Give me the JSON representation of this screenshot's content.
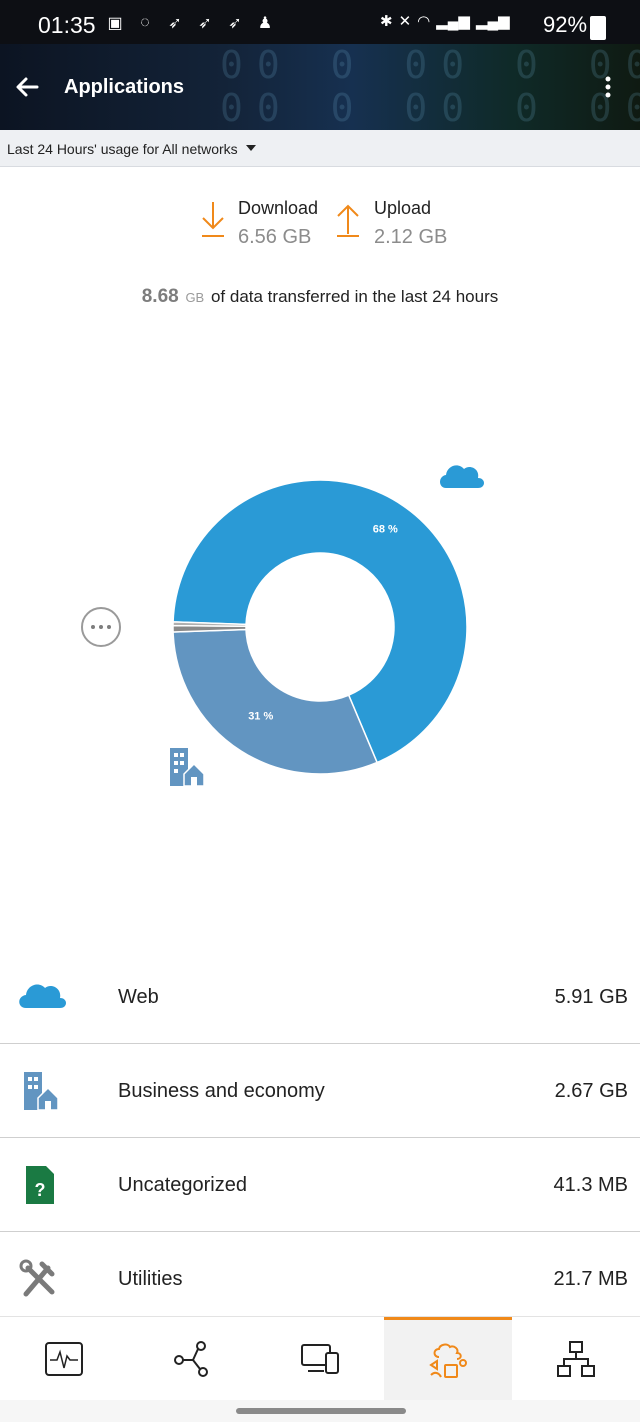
{
  "status_bar": {
    "time": "01:35",
    "battery": "92%"
  },
  "app_bar": {
    "title": "Applications"
  },
  "filter": {
    "label": "Last 24 Hours' usage for All networks"
  },
  "transfer": {
    "download_label": "Download",
    "download_value": "6.56 GB",
    "upload_label": "Upload",
    "upload_value": "2.12 GB"
  },
  "summary": {
    "total": "8.68",
    "unit": "GB",
    "text": "of data transferred in the last 24 hours"
  },
  "colors": {
    "web": "#2a9ad6",
    "business": "#6295c1",
    "uncategorized": "#8a8a8a",
    "utilities": "#b0b0b0",
    "accent": "#f0891a",
    "green": "#1a7a43"
  },
  "chart_data": {
    "type": "pie",
    "slices": [
      {
        "label": "68 %",
        "value": 68.1
      },
      {
        "label": "31 %",
        "value": 30.8
      },
      {
        "label": "",
        "value": 0.7
      },
      {
        "label": "",
        "value": 0.4
      }
    ]
  },
  "categories": [
    {
      "name": "Web",
      "value": "5.91 GB",
      "icon": "cloud-icon"
    },
    {
      "name": "Business and economy",
      "value": "2.67 GB",
      "icon": "building-icon"
    },
    {
      "name": "Uncategorized",
      "value": "41.3 MB",
      "icon": "unknown-file-icon"
    },
    {
      "name": "Utilities",
      "value": "21.7 MB",
      "icon": "tools-icon"
    }
  ],
  "bottom_nav": [
    {
      "icon": "activity-icon"
    },
    {
      "icon": "network-icon"
    },
    {
      "icon": "devices-icon"
    },
    {
      "icon": "applications-icon",
      "active": true
    },
    {
      "icon": "topology-icon"
    }
  ]
}
